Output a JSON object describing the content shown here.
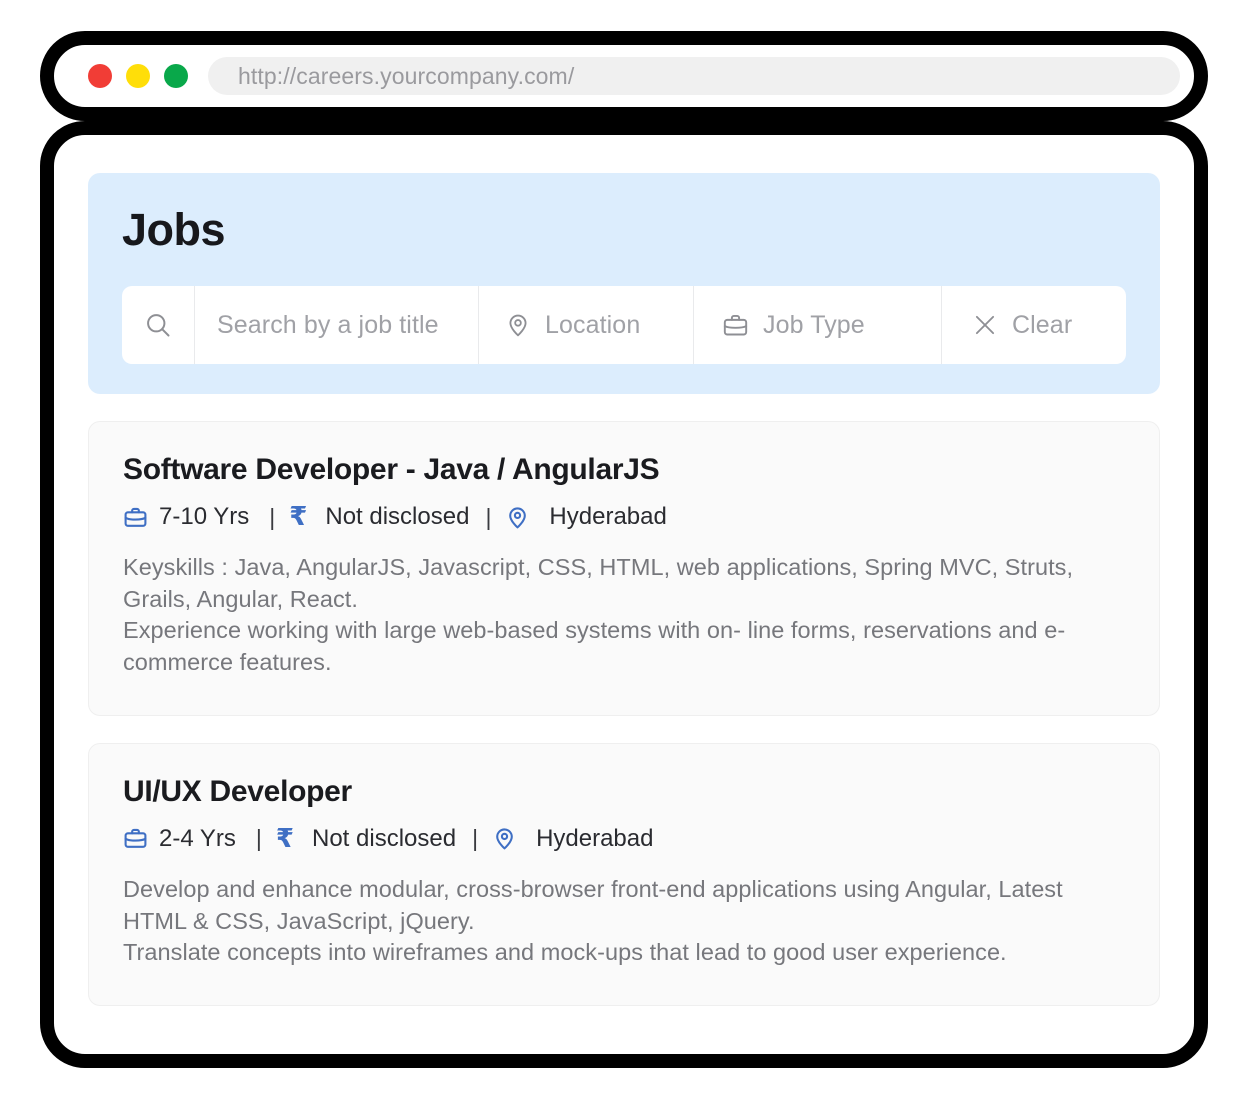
{
  "browser": {
    "url": "http://careers.yourcompany.com/",
    "traffic_lights": [
      {
        "name": "close",
        "color": "#f13d36"
      },
      {
        "name": "minimize",
        "color": "#ffde09"
      },
      {
        "name": "maximize",
        "color": "#09a84a"
      }
    ]
  },
  "colors": {
    "panel_background": "#dcedfd",
    "accent_blue": "#3f6fc4",
    "card_background": "#fafafa",
    "card_border": "#efefef",
    "placeholder_text": "#a0a1a6",
    "body_text": "#76777c",
    "heading_text": "#17181c"
  },
  "panel": {
    "title": "Jobs",
    "search": {
      "search_icon": "search-icon",
      "job_title_placeholder": "Search by a job title",
      "location_icon": "map-pin-icon",
      "location_placeholder": "Location",
      "job_type_icon": "briefcase-icon",
      "job_type_placeholder": "Job Type",
      "clear_icon": "close-x-icon",
      "clear_label": "Clear"
    }
  },
  "jobs": [
    {
      "title": "Software Developer - Java / AngularJS",
      "experience_icon": "briefcase-icon",
      "experience": "7-10 Yrs",
      "salary_icon": "rupee-icon",
      "salary": "Not disclosed",
      "location_icon": "map-pin-icon",
      "location": "Hyderabad",
      "separator": "|",
      "description_lines": [
        "Keyskills : Java, AngularJS, Javascript, CSS, HTML, web applications, Spring MVC, Struts, Grails, Angular, React.",
        "Experience working with large web-based systems with on- line forms, reservations and e-commerce features."
      ]
    },
    {
      "title": "UI/UX Developer",
      "experience_icon": "briefcase-icon",
      "experience": "2-4  Yrs",
      "salary_icon": "rupee-icon",
      "salary": "Not disclosed",
      "location_icon": "map-pin-icon",
      "location": "Hyderabad",
      "separator": "|",
      "description_lines": [
        "Develop and enhance modular, cross-browser front-end applications using Angular, Latest HTML & CSS, JavaScript, jQuery.",
        "Translate concepts into wireframes and mock-ups that lead to good user experience."
      ]
    }
  ]
}
